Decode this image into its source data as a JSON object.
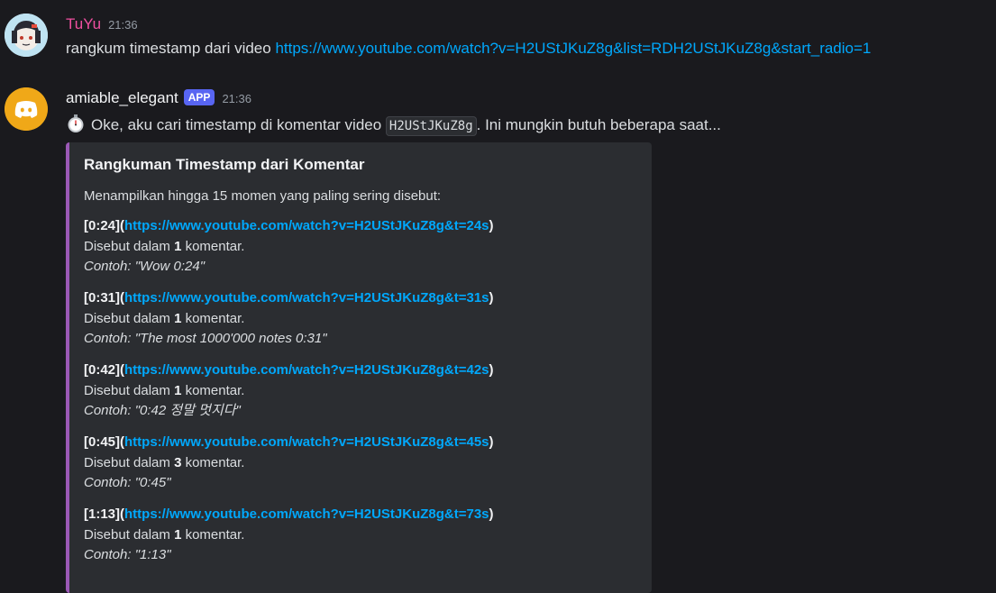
{
  "messages": [
    {
      "username": "TuYu",
      "username_color": "#f04fa0",
      "time": "21:36",
      "text": "rangkum timestamp dari video ",
      "link": "https://www.youtube.com/watch?v=H2UStJKuZ8g&list=RDH2UStJKuZ8g&start_radio=1"
    },
    {
      "username": "amiable_elegant",
      "username_color": "#f2f3f5",
      "badge": "APP",
      "time": "21:36",
      "emoji_icon": "stopwatch-icon",
      "text_before": "Oke, aku cari timestamp di komentar video",
      "code": "H2UStJKuZ8g",
      "text_after": ". Ini mungkin butuh beberapa saat..."
    }
  ],
  "embed": {
    "accent_color": "#9b59b6",
    "title": "Rangkuman Timestamp dari Komentar",
    "description": "Menampilkan hingga 15 momen yang paling sering disebut:",
    "entries": [
      {
        "ts": "[0:24]",
        "open": "(",
        "link": "https://www.youtube.com/watch?v=H2UStJKuZ8g&t=24s",
        "close": ")",
        "mention_prefix": "Disebut dalam ",
        "count": "1",
        "mention_suffix": " komentar.",
        "example": "Contoh: \"Wow 0:24\""
      },
      {
        "ts": "[0:31]",
        "open": "(",
        "link": "https://www.youtube.com/watch?v=H2UStJKuZ8g&t=31s",
        "close": ")",
        "mention_prefix": "Disebut dalam ",
        "count": "1",
        "mention_suffix": " komentar.",
        "example": "Contoh: \"The most 1000'000 notes 0:31\""
      },
      {
        "ts": "[0:42]",
        "open": "(",
        "link": "https://www.youtube.com/watch?v=H2UStJKuZ8g&t=42s",
        "close": ")",
        "mention_prefix": "Disebut dalam ",
        "count": "1",
        "mention_suffix": " komentar.",
        "example": "Contoh: \"0:42 정말 멋지다\""
      },
      {
        "ts": "[0:45]",
        "open": "(",
        "link": "https://www.youtube.com/watch?v=H2UStJKuZ8g&t=45s",
        "close": ")",
        "mention_prefix": "Disebut dalam ",
        "count": "3",
        "mention_suffix": " komentar.",
        "example": "Contoh: \"0:45\""
      },
      {
        "ts": "[1:13]",
        "open": "(",
        "link": "https://www.youtube.com/watch?v=H2UStJKuZ8g&t=73s",
        "close": ")",
        "mention_prefix": "Disebut dalam ",
        "count": "1",
        "mention_suffix": " komentar.",
        "example": "Contoh: \"1:13\""
      }
    ]
  }
}
